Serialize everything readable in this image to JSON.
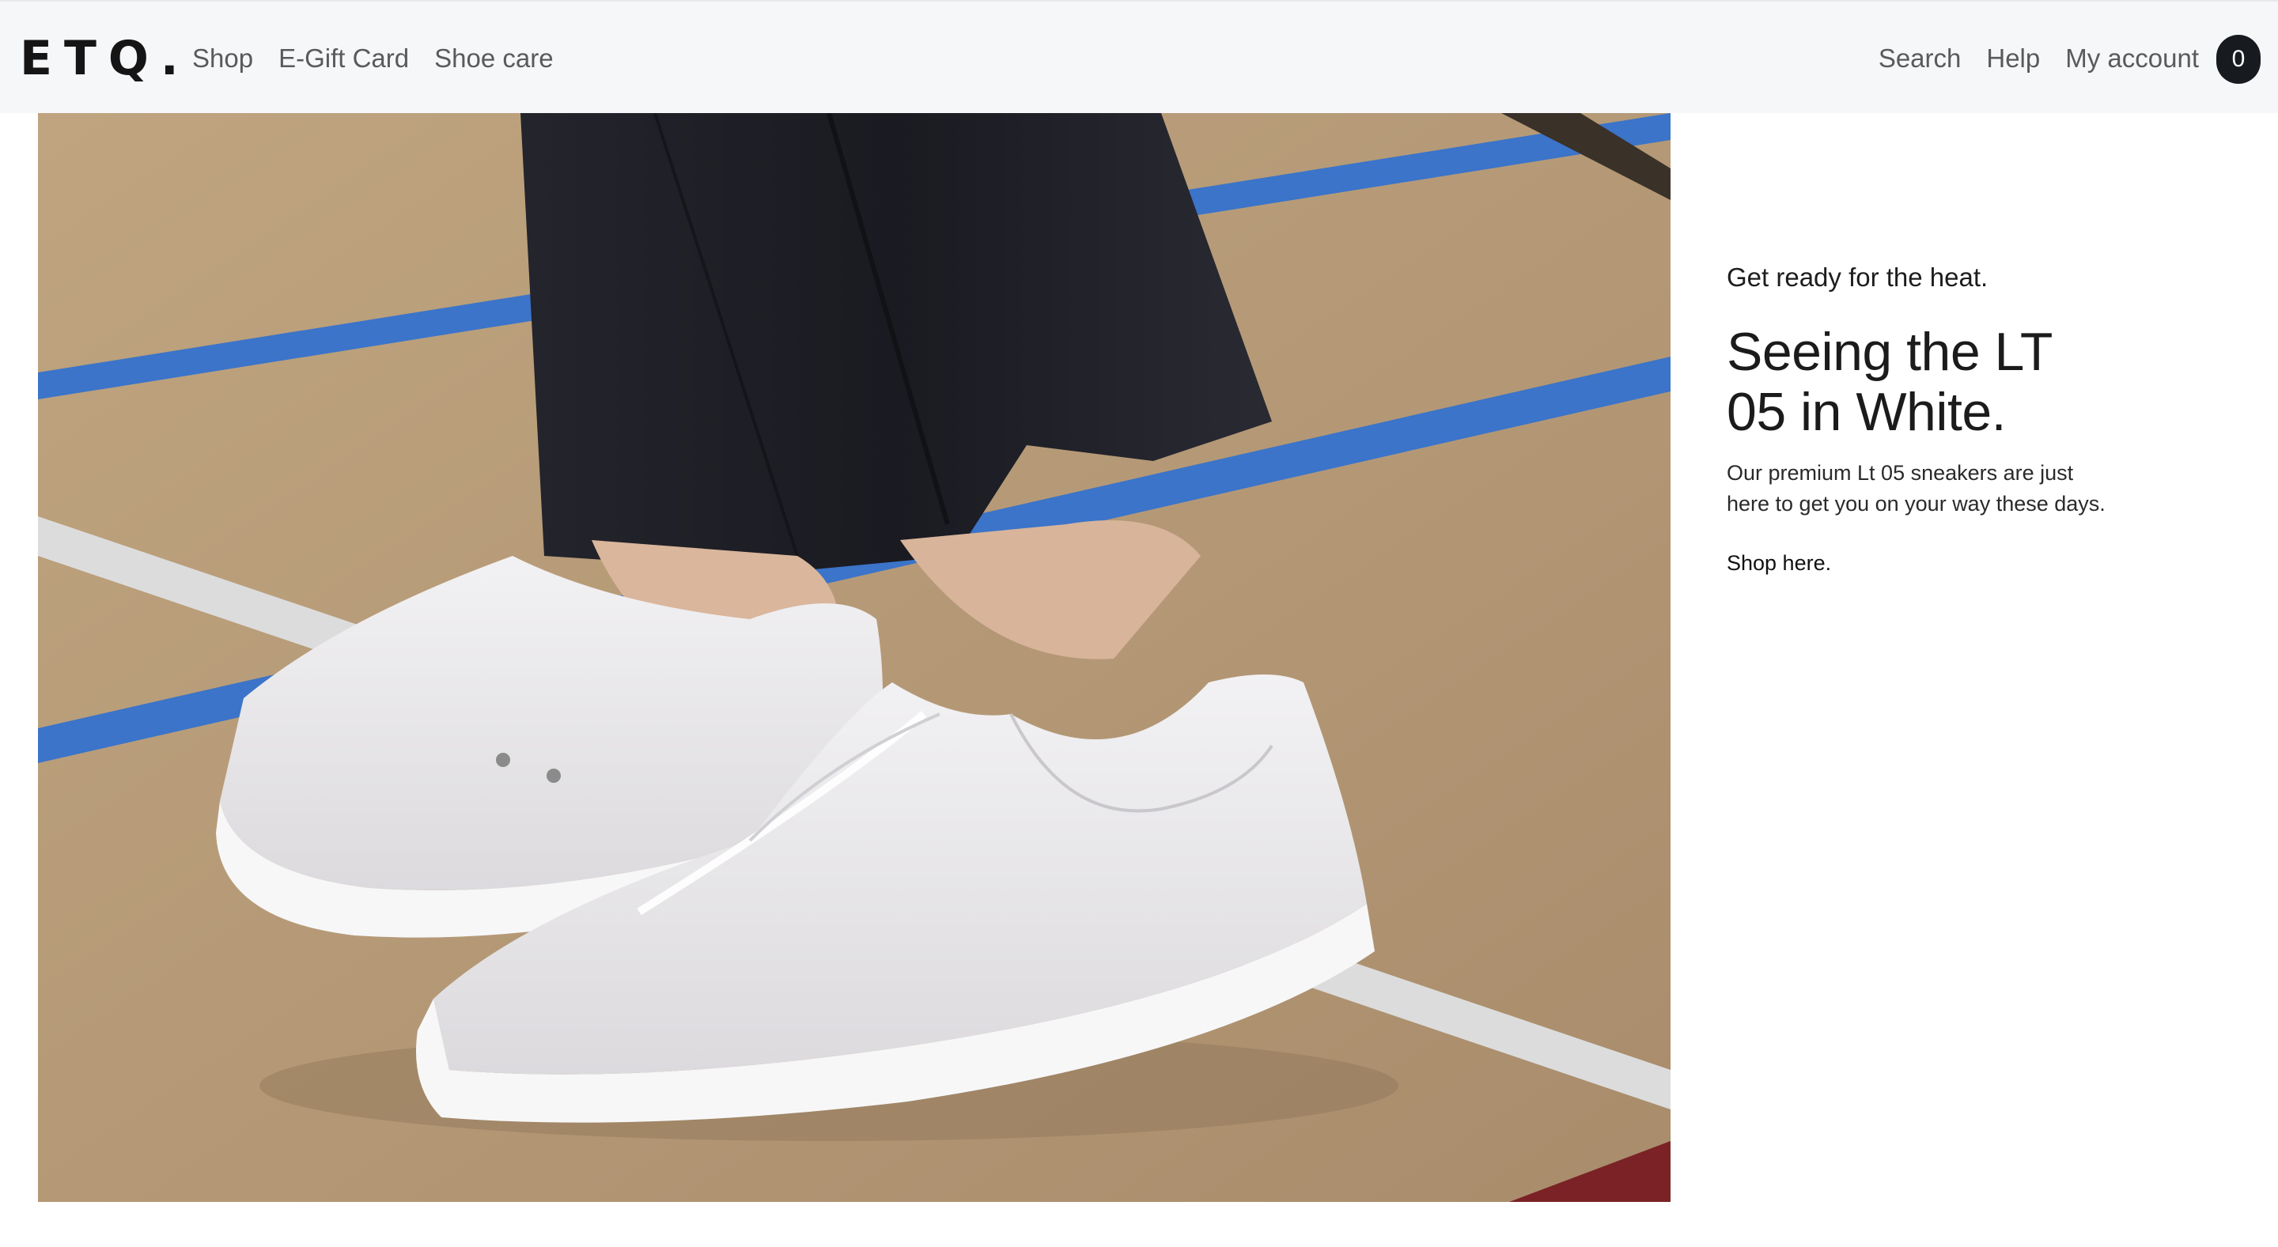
{
  "brand": {
    "logo": "ETQ."
  },
  "nav": {
    "left": [
      "Shop",
      "E-Gift Card",
      "Shoe care"
    ],
    "right": [
      "Search",
      "Help",
      "My account"
    ]
  },
  "cart": {
    "count": "0"
  },
  "hero": {
    "image_alt": "White LT 05 leather sneakers worn with dark trousers on a tan sports court floor",
    "eyebrow": "Get ready for the heat.",
    "headline_line1": "Seeing the LT",
    "headline_line2": "05 in White.",
    "body_line1": "Our premium Lt 05 sneakers are just",
    "body_line2": "here to get you on your way these days.",
    "cta": "Shop here."
  },
  "colors": {
    "header_bg": "#f6f7f9",
    "floor": "#b49a76",
    "court_blue": "#3b74c9",
    "trousers": "#1e1e26",
    "sneaker": "#e9e8ea",
    "cart_badge": "#171a1e"
  }
}
